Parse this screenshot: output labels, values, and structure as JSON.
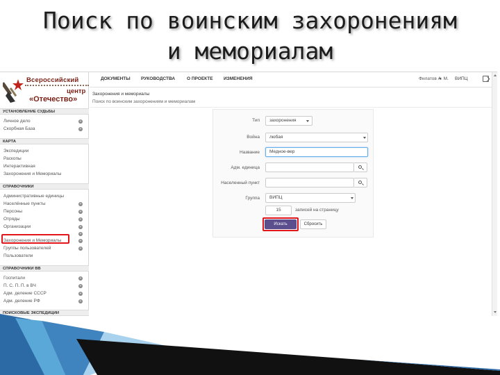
{
  "slide": {
    "title_line1": "Поиск по воинским захоронениям",
    "title_line2": "и мемориалам"
  },
  "logo": {
    "line1": "Всероссийский",
    "line3": "центр",
    "line4": "«Отечество»"
  },
  "sidebar": {
    "sections": [
      {
        "title": "УСТАНОВЛЕНИЕ СУДЬБЫ",
        "items": [
          {
            "label": "Личное дело",
            "plus": true
          },
          {
            "label": "Скорбная База",
            "plus": true
          }
        ]
      },
      {
        "title": "КАРТА",
        "items": [
          {
            "label": "Экспедиции"
          },
          {
            "label": "Раскопы"
          },
          {
            "label": "Интерактивная"
          },
          {
            "label": "Захоронения и Мемориалы"
          }
        ]
      },
      {
        "title": "СПРАВОЧНИКИ",
        "items": [
          {
            "label": "Административные единицы"
          },
          {
            "label": "Населённые пункты",
            "plus": true
          },
          {
            "label": "Персоны",
            "plus": true
          },
          {
            "label": "Отряды",
            "plus": true
          },
          {
            "label": "Организации",
            "plus": true
          },
          {
            "label": "",
            "plus": true
          },
          {
            "label": "Захоронения и Мемориалы",
            "plus": true,
            "highlighted": true
          },
          {
            "label": "Группы пользователей",
            "plus": true
          },
          {
            "label": "Пользователи"
          }
        ]
      },
      {
        "title": "СПРАВОЧНИКИ ВВ",
        "items": [
          {
            "label": "Госпитали",
            "plus": true
          },
          {
            "label": "П. С. П. П. в ВЧ",
            "plus": true
          },
          {
            "label": "Адм. деление СССР",
            "plus": true
          },
          {
            "label": "Адм. деление РФ",
            "plus": true
          }
        ]
      },
      {
        "title": "ПОИСКОВЫЕ ЭКСПЕДИЦИИ",
        "items": []
      }
    ]
  },
  "topnav": {
    "items": [
      "ДОКУМЕНТЫ",
      "РУКОВОДСТВА",
      "О ПРОЕКТЕ",
      "ИЗМЕНЕНИЯ"
    ],
    "user": "Филатов А. М.",
    "link": "ВИПЦ"
  },
  "breadcrumb": {
    "title": "Захоронения и мемориалы",
    "subtitle": "Поиск по воинским захоронениям и мемориалам"
  },
  "form": {
    "type": {
      "label": "Тип",
      "value": "захоронения"
    },
    "war": {
      "label": "Война",
      "value": "любая"
    },
    "name": {
      "label": "Название",
      "value": "Медное-вер"
    },
    "admin_unit": {
      "label": "Адм. единица",
      "value": ""
    },
    "locality": {
      "label": "Населенный пункт",
      "value": ""
    },
    "group": {
      "label": "Группа",
      "value": "ВИПЦ"
    },
    "per_page": {
      "value": "15",
      "label": "записей на страницу"
    },
    "search_button": "Искать",
    "reset_button": "Сбросить"
  },
  "colors": {
    "accent_button": "#5b4f8e",
    "highlight_frame": "#e2151b",
    "logo_text": "#7a1f14"
  }
}
